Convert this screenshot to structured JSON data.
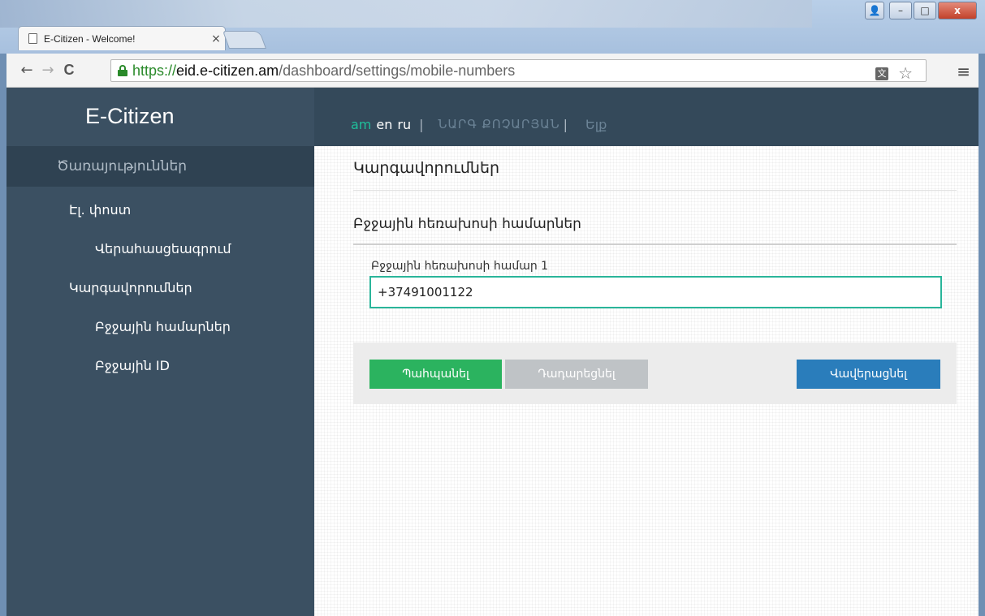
{
  "browser": {
    "tab_title": "E-Citizen - Welcome!",
    "tab_close": "×",
    "url_scheme": "https://",
    "url_host": "eid.e-citizen.am",
    "url_path": "/dashboard/settings/mobile-numbers",
    "back": "←",
    "forward": "→",
    "reload": "C",
    "star": "☆",
    "menu": "≡",
    "translate": "文",
    "win_user": "👤",
    "win_min": "–",
    "win_max": "□",
    "win_close": "x"
  },
  "sidebar": {
    "brand": "E-Citizen",
    "section": "Ծառայություններ",
    "items": [
      {
        "label": "Էլ. փոստ",
        "level": 1
      },
      {
        "label": "Վերահասցեագրում",
        "level": 2
      },
      {
        "label": "Կարգավորումներ",
        "level": 1
      },
      {
        "label": "Բջջային համարներ",
        "level": 2
      },
      {
        "label": "Բջջային ID",
        "level": 2
      }
    ]
  },
  "topnav": {
    "lang_am": "am",
    "lang_en": "en",
    "lang_ru": "ru",
    "separator": "|",
    "username": "ՆԱՐԳ ՔՈՉԱՐՅԱՆ",
    "logout": "Ելք"
  },
  "main": {
    "page_title": "Կարգավորումներ",
    "section_title": "Բջջային հեռախոսի համարներ",
    "field_label": "Բջջային հեռախոսի համար 1",
    "phone_value": "+37491001122",
    "save_label": "Պահպանել",
    "reset_label": "Դադարեցնել",
    "finish_label": "Վավերացնել"
  },
  "colors": {
    "sidebar_bg": "#3b5062",
    "accent_green": "#2bb35f",
    "accent_blue": "#2a7dbb",
    "input_border": "#2ab59a"
  }
}
